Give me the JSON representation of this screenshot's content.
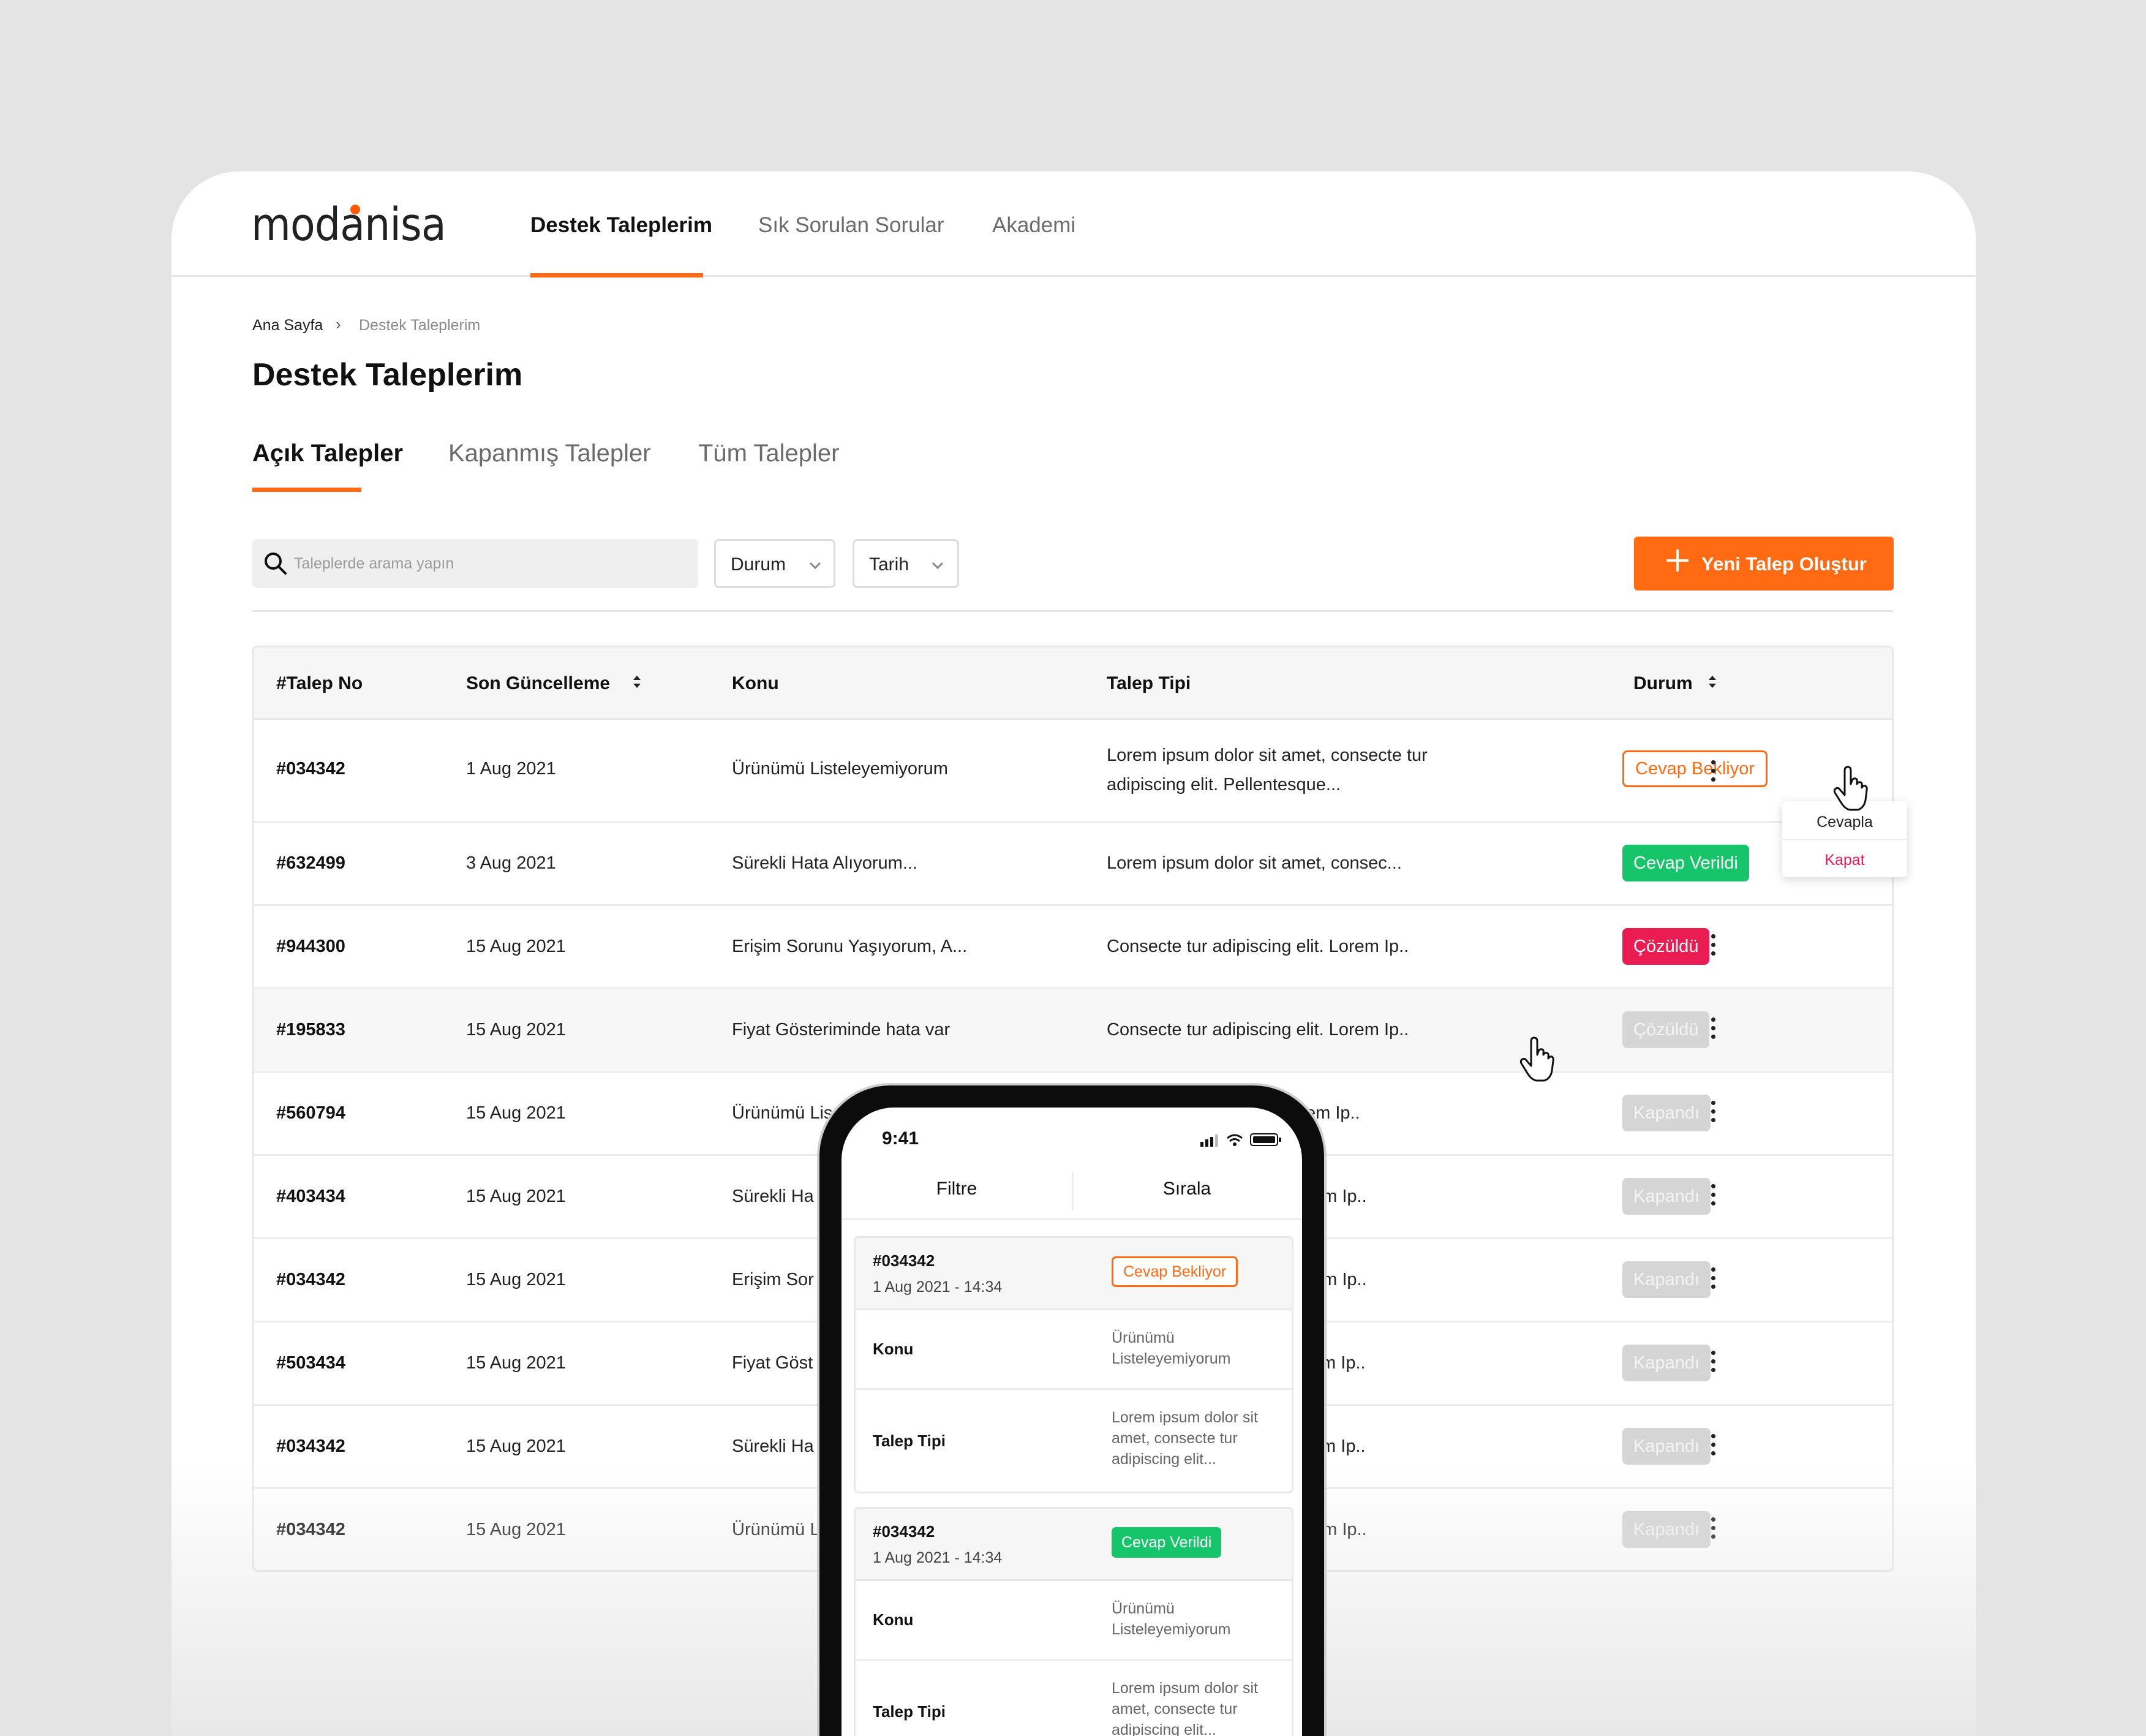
{
  "brand": {
    "logo_text": "modanisa",
    "accent": "#ff6a13",
    "logo_dot": "#ff5a00"
  },
  "nav": {
    "items": [
      "Destek Taleplerim",
      "Sık Sorulan Sorular",
      "Akademi"
    ],
    "active": "Destek Taleplerim"
  },
  "breadcrumb": {
    "home": "Ana Sayfa",
    "separator": "›",
    "current": "Destek Taleplerim"
  },
  "page_title": "Destek Taleplerim",
  "tabs": [
    "Açık Talepler",
    "Kapanmış Talepler",
    "Tüm Talepler"
  ],
  "search": {
    "placeholder": "Taleplerde arama yapın",
    "icon": "search-icon"
  },
  "filters": {
    "status_label": "Durum",
    "date_label": "Tarih"
  },
  "new_button": {
    "label": "Yeni Talep Oluştur",
    "icon": "plus-icon"
  },
  "table": {
    "columns": {
      "no": "#Talep No",
      "updated": "Son Güncelleme",
      "subject": "Konu",
      "type": "Talep Tipi",
      "status": "Durum"
    },
    "rows": [
      {
        "no": "#034342",
        "updated": "1 Aug 2021",
        "subject": "Ürünümü Listeleyemiyorum",
        "type": "Lorem ipsum dolor sit amet, consecte tur adipiscing elit. Pellentesque...",
        "status": "Cevap Bekliyor"
      },
      {
        "no": "#632499",
        "updated": "3 Aug 2021",
        "subject": "Sürekli Hata Alıyorum...",
        "type": "Lorem ipsum dolor sit amet, consec...",
        "status": "Cevap Verildi"
      },
      {
        "no": "#944300",
        "updated": "15 Aug 2021",
        "subject": "Erişim Sorunu Yaşıyorum, A...",
        "type": "Consecte tur adipiscing elit. Lorem Ip..",
        "status": "Çözüldü"
      },
      {
        "no": "#195833",
        "updated": "15 Aug 2021",
        "subject": "Fiyat Gösteriminde hata var",
        "type": "Consecte tur adipiscing elit. Lorem Ip..",
        "status": "Çözüldü"
      },
      {
        "no": "#560794",
        "updated": "15 Aug 2021",
        "subject": "Ürünümü Lis",
        "type": "lit. Lorem Ip..",
        "status": "Kapandı"
      },
      {
        "no": "#403434",
        "updated": "15 Aug 2021",
        "subject": "Sürekli Ha",
        "type": ". Lorem Ip..",
        "status": "Kapandı"
      },
      {
        "no": "#034342",
        "updated": "15 Aug 2021",
        "subject": "Erişim Sor",
        "type": ". Lorem Ip..",
        "status": "Kapandı"
      },
      {
        "no": "#503434",
        "updated": "15 Aug 2021",
        "subject": "Fiyat Göst",
        "type": "Lorem Ip..",
        "status": "Kapandı"
      },
      {
        "no": "#034342",
        "updated": "15 Aug 2021",
        "subject": "Sürekli Ha",
        "type": "Lorem Ip..",
        "status": "Kapandı"
      },
      {
        "no": "#034342",
        "updated": "15 Aug 2021",
        "subject": "Ürünümü L",
        "type": ". Lorem Ip..",
        "status": "Kapandı"
      }
    ]
  },
  "row_menu": {
    "reply": "Cevapla",
    "close": "Kapat"
  },
  "status_colors": {
    "waiting": "#ff6a13",
    "answered": "#16c56a",
    "solved": "#ea1c51",
    "closed": "#d5d5d5"
  },
  "mobile": {
    "time": "9:41",
    "filter_label": "Filtre",
    "sort_label": "Sırala",
    "cards": [
      {
        "no": "#034342",
        "date": "1 Aug 2021 - 14:34",
        "status": "Cevap Bekliyor",
        "subject_key": "Konu",
        "subject": "Ürünümü Listeleyemiyorum",
        "type_key": "Talep Tipi",
        "type": "Lorem ipsum dolor sit amet, consecte tur adipiscing elit..."
      },
      {
        "no": "#034342",
        "date": "1 Aug 2021 - 14:34",
        "status": "Cevap Verildi",
        "subject_key": "Konu",
        "subject": "Ürünümü Listeleyemiyorum",
        "type_key": "Talep Tipi",
        "type": "Lorem ipsum dolor sit amet, consecte tur adipiscing elit..."
      }
    ]
  }
}
